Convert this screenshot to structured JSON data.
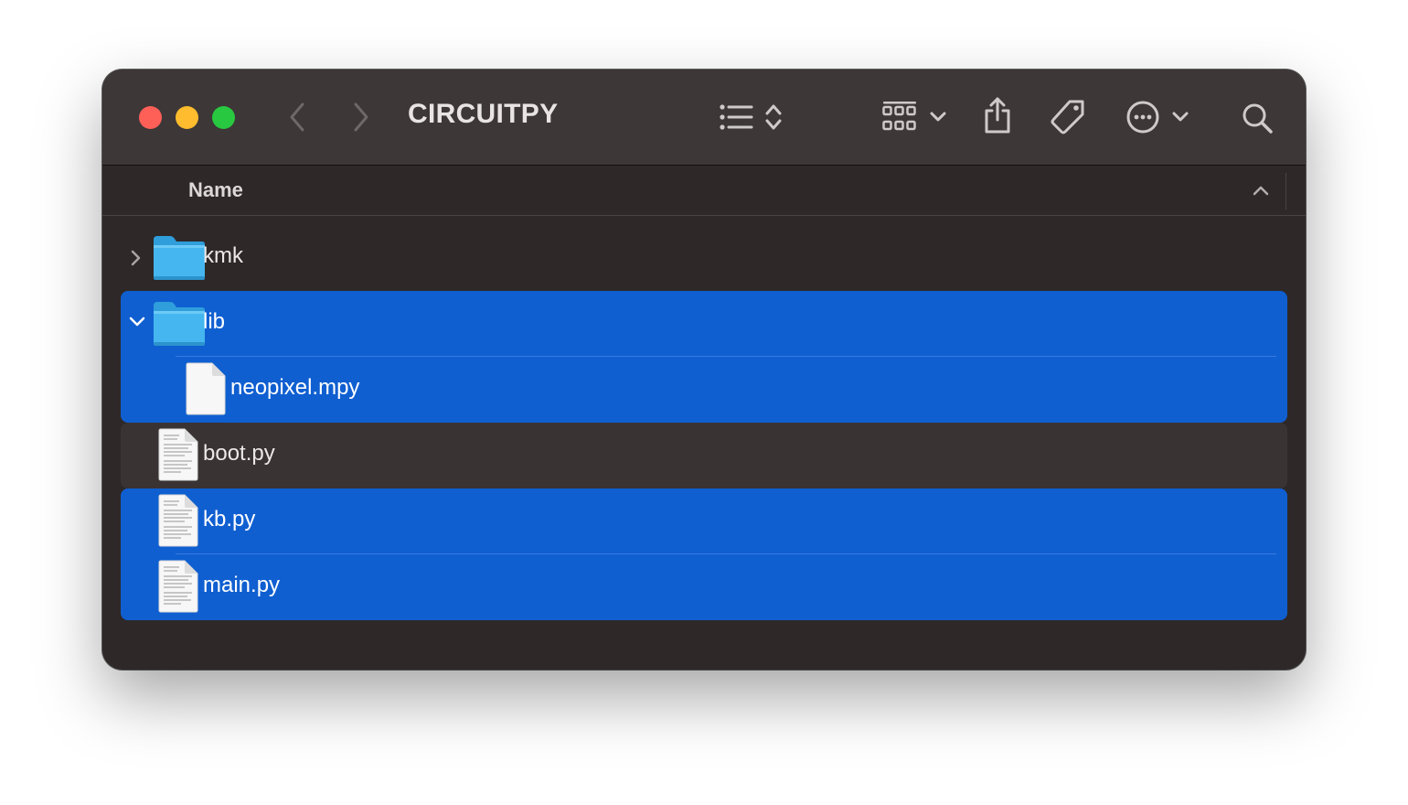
{
  "window": {
    "title": "CIRCUITPY"
  },
  "toolbar": {
    "icons": [
      "chevron-left-icon",
      "chevron-right-icon",
      "list-view-icon",
      "sort-stepper-icon",
      "grid-group-icon",
      "chevron-down-icon",
      "share-icon",
      "tag-icon",
      "more-icon",
      "chevron-down-icon",
      "search-icon"
    ]
  },
  "columns": {
    "name_header": "Name",
    "sort_direction": "ascending"
  },
  "files": [
    {
      "name": "kmk",
      "kind": "folder",
      "expanded": false,
      "selected": false
    },
    {
      "name": "lib",
      "kind": "folder",
      "expanded": true,
      "selected": true
    },
    {
      "name": "neopixel.mpy",
      "kind": "file",
      "selected": true,
      "parent": "lib"
    },
    {
      "name": "boot.py",
      "kind": "text-file",
      "selected": false
    },
    {
      "name": "kb.py",
      "kind": "text-file",
      "selected": true
    },
    {
      "name": "main.py",
      "kind": "text-file",
      "selected": true
    }
  ],
  "colors": {
    "selection": "#0f5fd1",
    "folder": "#3fb2ec",
    "toolbar": "#3d3737",
    "content": "#2e2828"
  }
}
